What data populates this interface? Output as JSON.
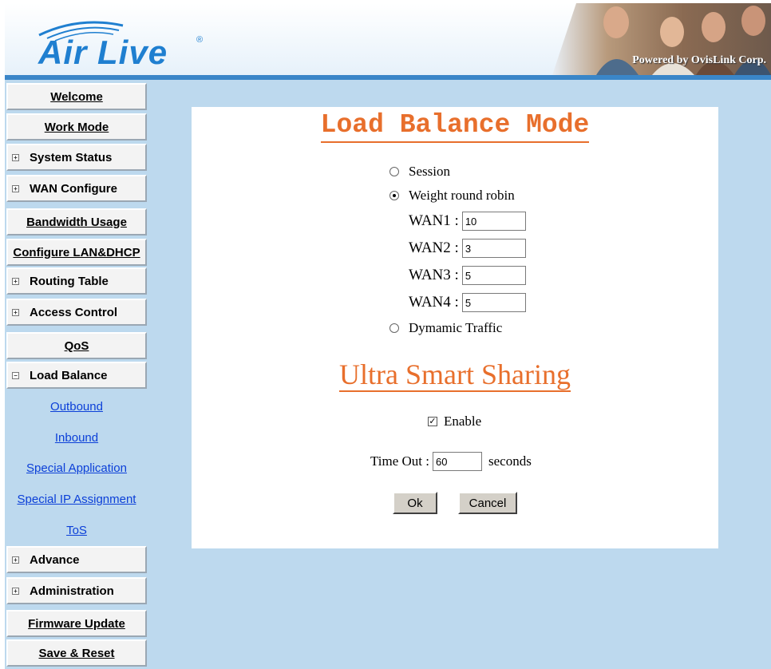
{
  "header": {
    "logo_text": "Air Live",
    "logo_mark": "®",
    "tagline": "Powered by OvisLink Corp."
  },
  "sidebar": {
    "items": [
      {
        "label": "Welcome",
        "toggle": ""
      },
      {
        "label": "Work Mode",
        "toggle": ""
      },
      {
        "label": "System Status",
        "toggle": "+"
      },
      {
        "label": "WAN Configure",
        "toggle": "+"
      },
      {
        "label": "Bandwidth Usage",
        "toggle": ""
      },
      {
        "label": "Configure LAN&DHCP",
        "toggle": ""
      },
      {
        "label": "Routing Table",
        "toggle": "+"
      },
      {
        "label": "Access Control",
        "toggle": "+"
      },
      {
        "label": "QoS",
        "toggle": ""
      },
      {
        "label": "Load Balance",
        "toggle": "−"
      },
      {
        "label": "Advance",
        "toggle": "+"
      },
      {
        "label": "Administration",
        "toggle": "+"
      },
      {
        "label": "Firmware Update",
        "toggle": ""
      },
      {
        "label": "Save & Reset",
        "toggle": ""
      }
    ],
    "load_balance_sub": [
      "Outbound",
      "Inbound",
      "Special Application",
      "Special IP Assignment",
      "ToS"
    ]
  },
  "main": {
    "title": "Load Balance Mode",
    "modes": {
      "session": "Session",
      "weight": "Weight round robin",
      "dynamic": "Dymamic Traffic",
      "selected": "weight"
    },
    "wans": [
      {
        "label": "WAN1 :",
        "value": "10"
      },
      {
        "label": "WAN2 :",
        "value": "3"
      },
      {
        "label": "WAN3 :",
        "value": "5"
      },
      {
        "label": "WAN4 :",
        "value": "5"
      }
    ],
    "uss_title": "Ultra Smart Sharing",
    "enable_label": "Enable",
    "enable_checked": true,
    "timeout_label": "Time Out :",
    "timeout_value": "60",
    "timeout_unit": "seconds",
    "ok_label": "Ok",
    "cancel_label": "Cancel"
  }
}
